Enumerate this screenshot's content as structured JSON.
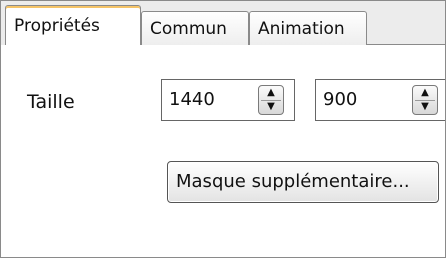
{
  "tabs": [
    {
      "label": "Propriétés",
      "active": true
    },
    {
      "label": "Commun",
      "active": false
    },
    {
      "label": "Animation",
      "active": false
    }
  ],
  "size": {
    "label": "Taille",
    "width": "1440",
    "height": "900"
  },
  "extra_mask_button": "Masque supplémentaire..."
}
